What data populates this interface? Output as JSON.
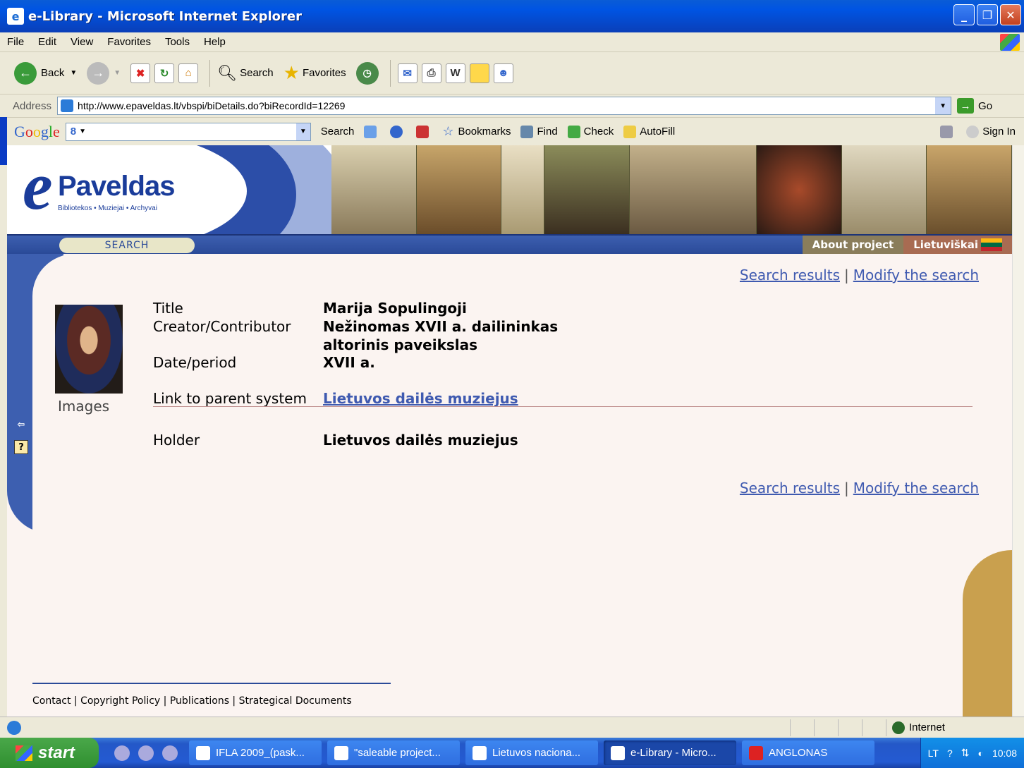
{
  "window": {
    "title": "e-Library - Microsoft Internet Explorer"
  },
  "menu": [
    "File",
    "Edit",
    "View",
    "Favorites",
    "Tools",
    "Help"
  ],
  "toolbar": {
    "back": "Back",
    "search": "Search",
    "favorites": "Favorites"
  },
  "address": {
    "label": "Address",
    "url": "http://www.epaveldas.lt/vbspi/biDetails.do?biRecordId=12269",
    "go": "Go"
  },
  "googlebar": {
    "logo": "Google",
    "g": "8",
    "search": "Search",
    "bookmarks": "Bookmarks",
    "find": "Find",
    "check": "Check",
    "autofill": "AutoFill",
    "signin": "Sign In"
  },
  "site": {
    "logo_e": "e",
    "logo_word": "Paveldas",
    "logo_sub": "Bibliotekos • Muziejai • Archyvai",
    "nav_search": "SEARCH",
    "about": "About project",
    "lang": "Lietuviškai",
    "colors": {
      "nav": "#2a4a98",
      "panel": "#fbf4f1",
      "gold": "#c9a04e"
    }
  },
  "links": {
    "results": "Search results",
    "sep": "|",
    "modify": "Modify the search"
  },
  "record": {
    "images_label": "Images",
    "fields": [
      {
        "label": "Title",
        "value": "Marija Sopulingoji"
      },
      {
        "label": "Creator/Contributor",
        "value": "Nežinomas XVII a. dailininkas"
      },
      {
        "label": "",
        "value": "altorinis paveikslas"
      },
      {
        "label": "Date/period",
        "value": "XVII a."
      },
      {
        "label": "Link to parent system",
        "value": "Lietuvos dailės muziejus"
      },
      {
        "label": "Holder",
        "value": "Lietuvos dailės muziejus"
      }
    ]
  },
  "footer": {
    "contact": "Contact",
    "copyright": "Copyright Policy",
    "publications": "Publications",
    "strategical": "Strategical Documents"
  },
  "status": {
    "zone": "Internet"
  },
  "taskbar": {
    "start": "start",
    "tasks": [
      "IFLA 2009_(pask...",
      "\"saleable project...",
      "Lietuvos naciona...",
      "e-Library - Micro...",
      "ANGLONAS"
    ],
    "lang": "LT",
    "time": "10:08"
  }
}
